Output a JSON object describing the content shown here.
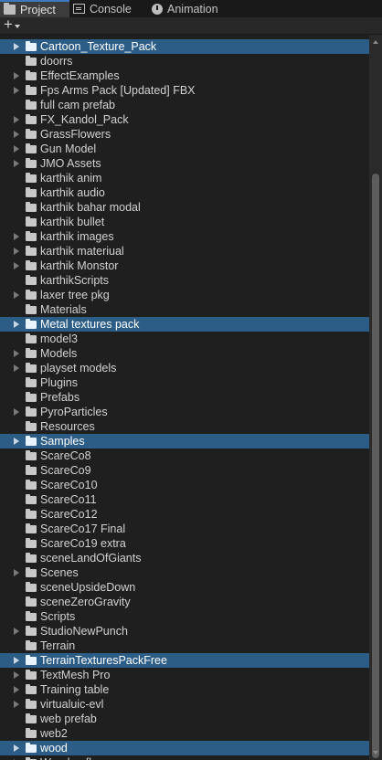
{
  "tabs": [
    {
      "label": "Project",
      "icon": "folder-icon",
      "active": true
    },
    {
      "label": "Console",
      "icon": "console-icon",
      "active": false
    },
    {
      "label": "Animation",
      "icon": "animation-icon",
      "active": false
    }
  ],
  "toolbar": {
    "add_label": "+",
    "add_icon": "plus-icon"
  },
  "colors": {
    "selection": "#2c5d87",
    "tab_accent": "#3a79bb",
    "background": "#1f1f1f"
  },
  "tree": {
    "items": [
      {
        "label": "Cartoon_Texture_Pack",
        "expandable": true,
        "selected": true
      },
      {
        "label": "doorrs",
        "expandable": false,
        "selected": false
      },
      {
        "label": "EffectExamples",
        "expandable": true,
        "selected": false
      },
      {
        "label": "Fps Arms Pack [Updated] FBX",
        "expandable": true,
        "selected": false
      },
      {
        "label": "full cam prefab",
        "expandable": false,
        "selected": false
      },
      {
        "label": "FX_Kandol_Pack",
        "expandable": true,
        "selected": false
      },
      {
        "label": "GrassFlowers",
        "expandable": true,
        "selected": false
      },
      {
        "label": "Gun Model",
        "expandable": true,
        "selected": false
      },
      {
        "label": "JMO Assets",
        "expandable": true,
        "selected": false
      },
      {
        "label": "karthik anim",
        "expandable": false,
        "selected": false
      },
      {
        "label": "karthik audio",
        "expandable": false,
        "selected": false
      },
      {
        "label": "karthik bahar modal",
        "expandable": false,
        "selected": false
      },
      {
        "label": "karthik bullet",
        "expandable": false,
        "selected": false
      },
      {
        "label": "karthik images",
        "expandable": true,
        "selected": false
      },
      {
        "label": "karthik materiual",
        "expandable": true,
        "selected": false
      },
      {
        "label": "karthik Monstor",
        "expandable": true,
        "selected": false
      },
      {
        "label": "karthikScripts",
        "expandable": false,
        "selected": false
      },
      {
        "label": "laxer tree pkg",
        "expandable": true,
        "selected": false
      },
      {
        "label": "Materials",
        "expandable": false,
        "selected": false
      },
      {
        "label": "Metal textures pack",
        "expandable": true,
        "selected": true
      },
      {
        "label": "model3",
        "expandable": false,
        "selected": false
      },
      {
        "label": "Models",
        "expandable": true,
        "selected": false
      },
      {
        "label": "playset models",
        "expandable": true,
        "selected": false
      },
      {
        "label": "Plugins",
        "expandable": false,
        "selected": false
      },
      {
        "label": "Prefabs",
        "expandable": false,
        "selected": false
      },
      {
        "label": "PyroParticles",
        "expandable": true,
        "selected": false
      },
      {
        "label": "Resources",
        "expandable": false,
        "selected": false
      },
      {
        "label": "Samples",
        "expandable": true,
        "selected": true
      },
      {
        "label": "ScareCo8",
        "expandable": false,
        "selected": false
      },
      {
        "label": "ScareCo9",
        "expandable": false,
        "selected": false
      },
      {
        "label": "ScareCo10",
        "expandable": false,
        "selected": false
      },
      {
        "label": "ScareCo11",
        "expandable": false,
        "selected": false
      },
      {
        "label": "ScareCo12",
        "expandable": false,
        "selected": false
      },
      {
        "label": "ScareCo17 Final",
        "expandable": false,
        "selected": false
      },
      {
        "label": "ScareCo19 extra",
        "expandable": false,
        "selected": false
      },
      {
        "label": "sceneLandOfGiants",
        "expandable": false,
        "selected": false
      },
      {
        "label": "Scenes",
        "expandable": true,
        "selected": false
      },
      {
        "label": "sceneUpsideDown",
        "expandable": false,
        "selected": false
      },
      {
        "label": "sceneZeroGravity",
        "expandable": false,
        "selected": false
      },
      {
        "label": "Scripts",
        "expandable": false,
        "selected": false
      },
      {
        "label": "StudioNewPunch",
        "expandable": true,
        "selected": false
      },
      {
        "label": "Terrain",
        "expandable": false,
        "selected": false
      },
      {
        "label": "TerrainTexturesPackFree",
        "expandable": true,
        "selected": true
      },
      {
        "label": "TextMesh Pro",
        "expandable": true,
        "selected": false
      },
      {
        "label": "Training table",
        "expandable": true,
        "selected": false
      },
      {
        "label": "virtualuic-evl",
        "expandable": true,
        "selected": false
      },
      {
        "label": "web prefab",
        "expandable": false,
        "selected": false
      },
      {
        "label": "web2",
        "expandable": false,
        "selected": false
      },
      {
        "label": "wood",
        "expandable": true,
        "selected": true
      },
      {
        "label": "Wooden floor",
        "expandable": true,
        "selected": false
      }
    ]
  }
}
